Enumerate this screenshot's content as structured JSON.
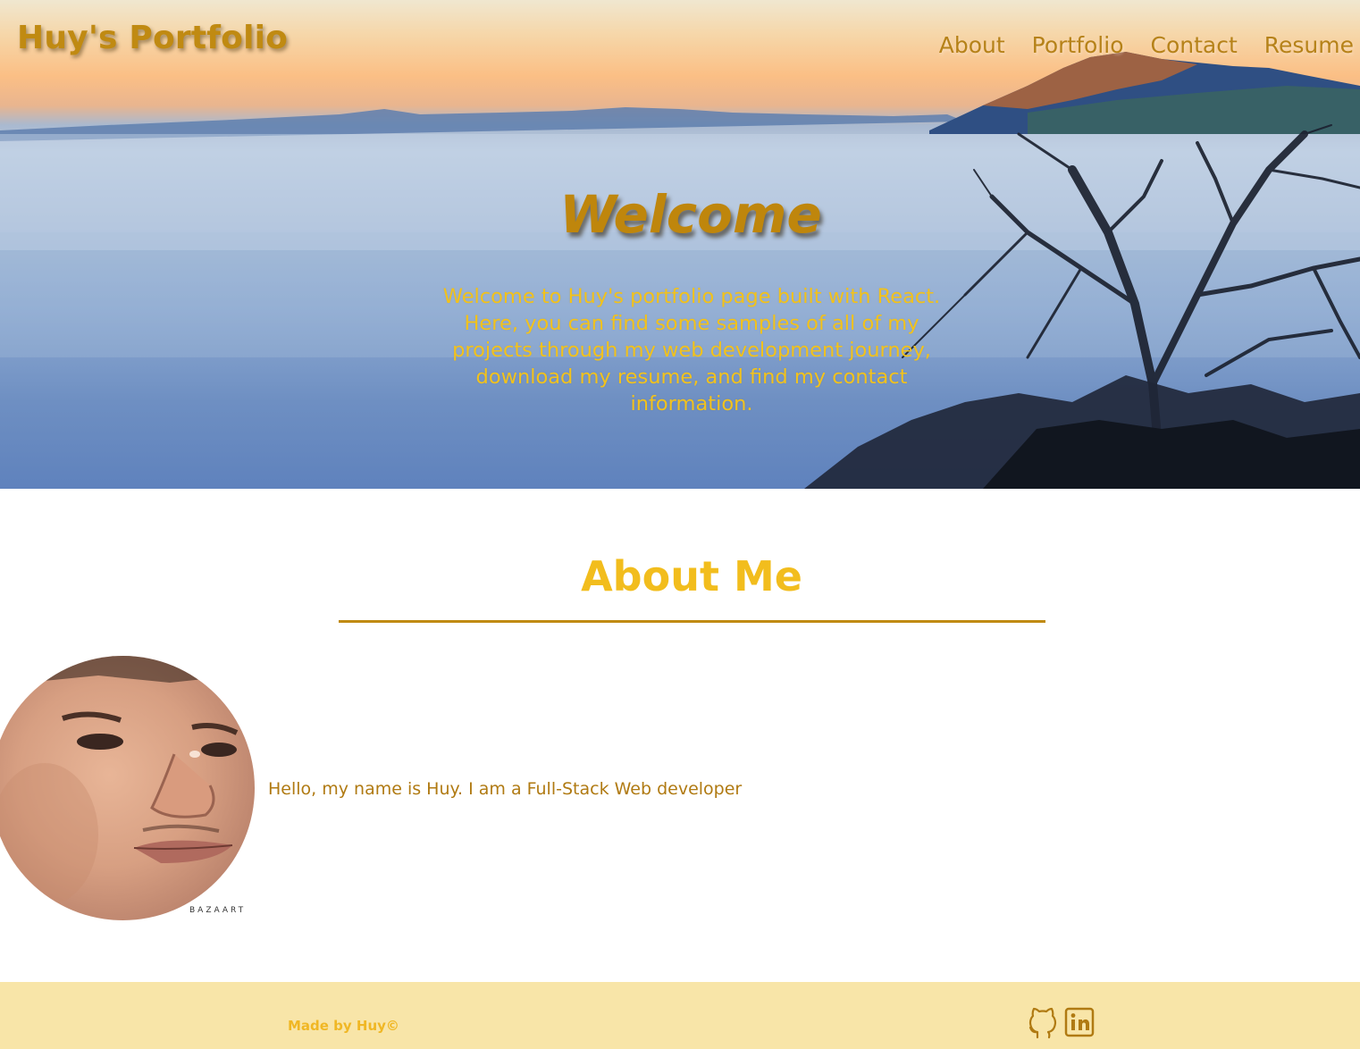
{
  "header": {
    "brand": "Huy's Portfolio",
    "nav": [
      "About",
      "Portfolio",
      "Contact",
      "Resume"
    ]
  },
  "hero": {
    "title": "Welcome",
    "text": "Welcome to Huy's portfolio page built with React. Here, you can find some samples of all of my projects through my web development journey, download my resume, and find my contact information."
  },
  "about": {
    "heading": "About Me",
    "avatar_watermark": "BAZAART",
    "text": "Hello, my name is Huy. I am a Full-Stack Web developer"
  },
  "footer": {
    "made_by": "Made by Huy©",
    "social_icons": [
      "github-icon",
      "linkedin-icon"
    ]
  },
  "colors": {
    "gold_dark": "#c08a12",
    "gold_bright": "#f2bd1d",
    "footer_bg": "#f8e5a8"
  }
}
